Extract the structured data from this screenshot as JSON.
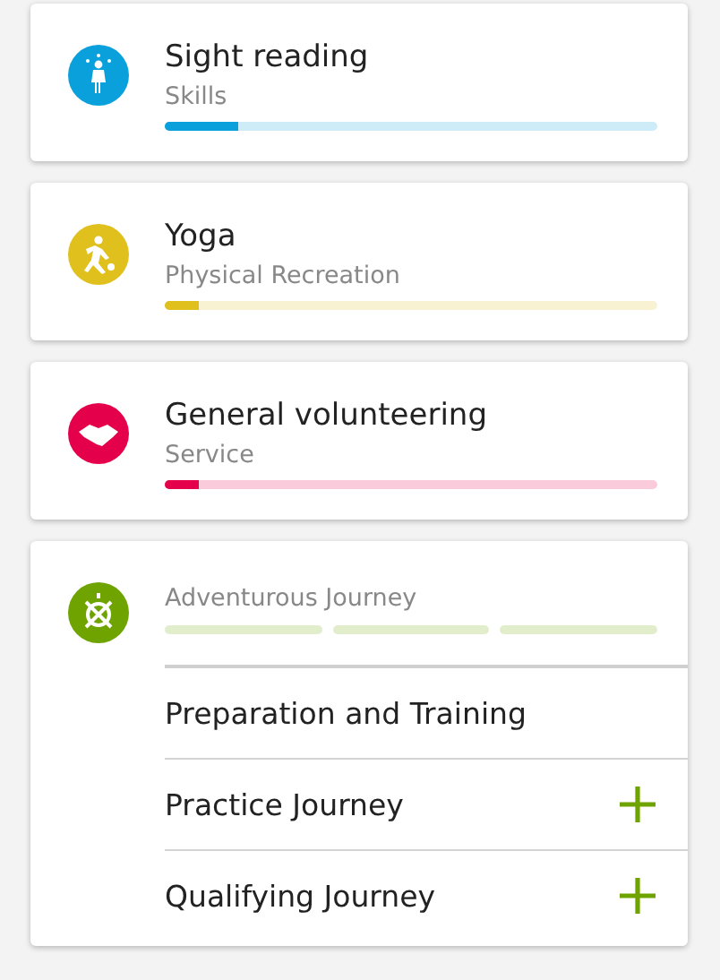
{
  "cards": [
    {
      "kind": "activity",
      "title": "Sight reading",
      "section": "Skills",
      "color": "#0aa0dc",
      "level": 0.15
    },
    {
      "kind": "activity",
      "title": "Yoga",
      "section": "Physical Recreation",
      "color": "#dfc01c",
      "level": 0.07
    },
    {
      "kind": "activity",
      "title": "General volunteering",
      "section": "Service",
      "color": "#e4004b",
      "level": 0.07
    },
    {
      "kind": "journey",
      "section": "Adventurous Journey",
      "color": "#6ea300",
      "segments": [
        {
          "level": 0
        },
        {
          "level": 0
        },
        {
          "level": 0
        }
      ],
      "items": [
        {
          "label": "Preparation and Training",
          "add": false
        },
        {
          "label": "Practice Journey",
          "add": true
        },
        {
          "label": "Qualifying Journey",
          "add": true
        }
      ]
    }
  ]
}
